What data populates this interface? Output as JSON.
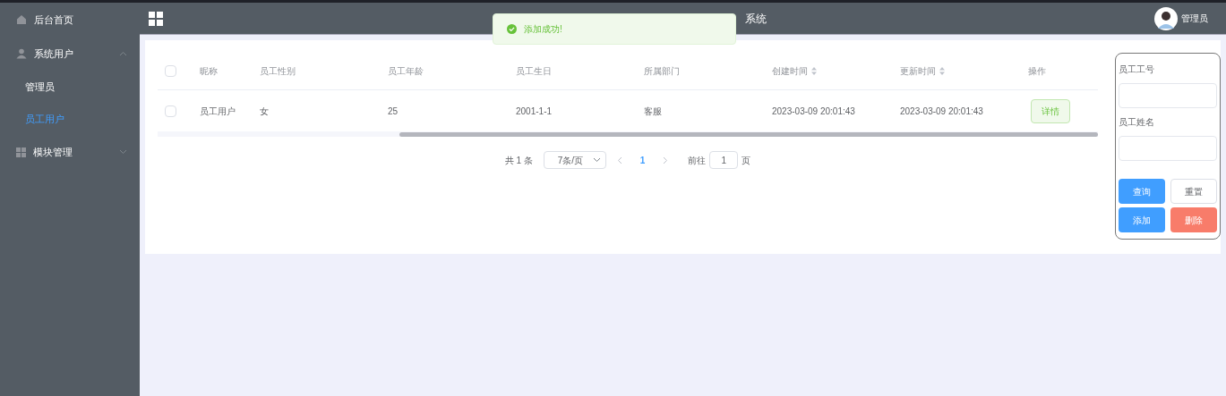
{
  "sidebar": {
    "items": [
      {
        "label": "后台首页",
        "kind": "link",
        "selected": false
      },
      {
        "label": "系统用户",
        "kind": "group",
        "expanded": true,
        "children": [
          {
            "label": "管理员",
            "selected": false
          },
          {
            "label": "员工用户",
            "selected": true
          }
        ]
      },
      {
        "label": "模块管理",
        "kind": "group",
        "expanded": false
      }
    ]
  },
  "header": {
    "title": "系统",
    "user": "管理员"
  },
  "toast": {
    "message": "添加成功!"
  },
  "table": {
    "columns": [
      {
        "label": "昵称",
        "sortable": false
      },
      {
        "label": "员工性别",
        "sortable": false
      },
      {
        "label": "员工年龄",
        "sortable": false
      },
      {
        "label": "员工生日",
        "sortable": false
      },
      {
        "label": "所属部门",
        "sortable": false
      },
      {
        "label": "创建时间",
        "sortable": true
      },
      {
        "label": "更新时间",
        "sortable": true
      },
      {
        "label": "操作",
        "sortable": false
      }
    ],
    "header_checked": false,
    "rows": [
      {
        "checked": false,
        "cells": [
          "员工用户",
          "女",
          "25",
          "2001-1-1",
          "客服",
          "2023-03-09 20:01:43",
          "2023-03-09 20:01:43"
        ],
        "action": "详情"
      }
    ]
  },
  "pagination": {
    "total": "共 1 条",
    "page_size": "7条/页",
    "pages": [
      {
        "label": "1",
        "selected": true
      }
    ],
    "goto_label": "前往",
    "goto_value": "1",
    "goto_suffix": "页"
  },
  "search_panel": {
    "fields": [
      {
        "label": "员工工号"
      },
      {
        "label": "员工姓名"
      }
    ],
    "buttons": [
      {
        "label": "查询",
        "kind": "primary"
      },
      {
        "label": "重置",
        "kind": "plain"
      },
      {
        "label": "添加",
        "kind": "primary"
      },
      {
        "label": "删除",
        "kind": "danger"
      }
    ]
  }
}
